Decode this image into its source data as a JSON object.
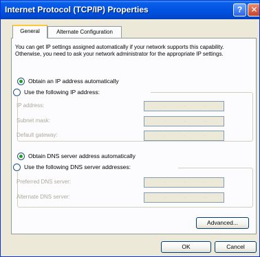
{
  "window": {
    "title": "Internet Protocol (TCP/IP) Properties",
    "help_label": "?",
    "close_label": "✕"
  },
  "tabs": [
    {
      "label": "General",
      "selected": true
    },
    {
      "label": "Alternate Configuration",
      "selected": false
    }
  ],
  "description": "You can get IP settings assigned automatically if your network supports this capability. Otherwise, you need to ask your network administrator for the appropriate IP settings.",
  "ip": {
    "auto_label": "Obtain an IP address automatically",
    "manual_label": "Use the following IP address:",
    "selected": "auto",
    "fields": [
      {
        "label": "IP address:"
      },
      {
        "label": "Subnet mask:"
      },
      {
        "label": "Default gateway:"
      }
    ]
  },
  "dns": {
    "auto_label": "Obtain DNS server address automatically",
    "manual_label": "Use the following DNS server addresses:",
    "selected": "auto",
    "fields": [
      {
        "label": "Preferred DNS server:"
      },
      {
        "label": "Alternate DNS server:"
      }
    ]
  },
  "buttons": {
    "advanced": "Advanced...",
    "ok": "OK",
    "cancel": "Cancel"
  },
  "ip_separator": "."
}
